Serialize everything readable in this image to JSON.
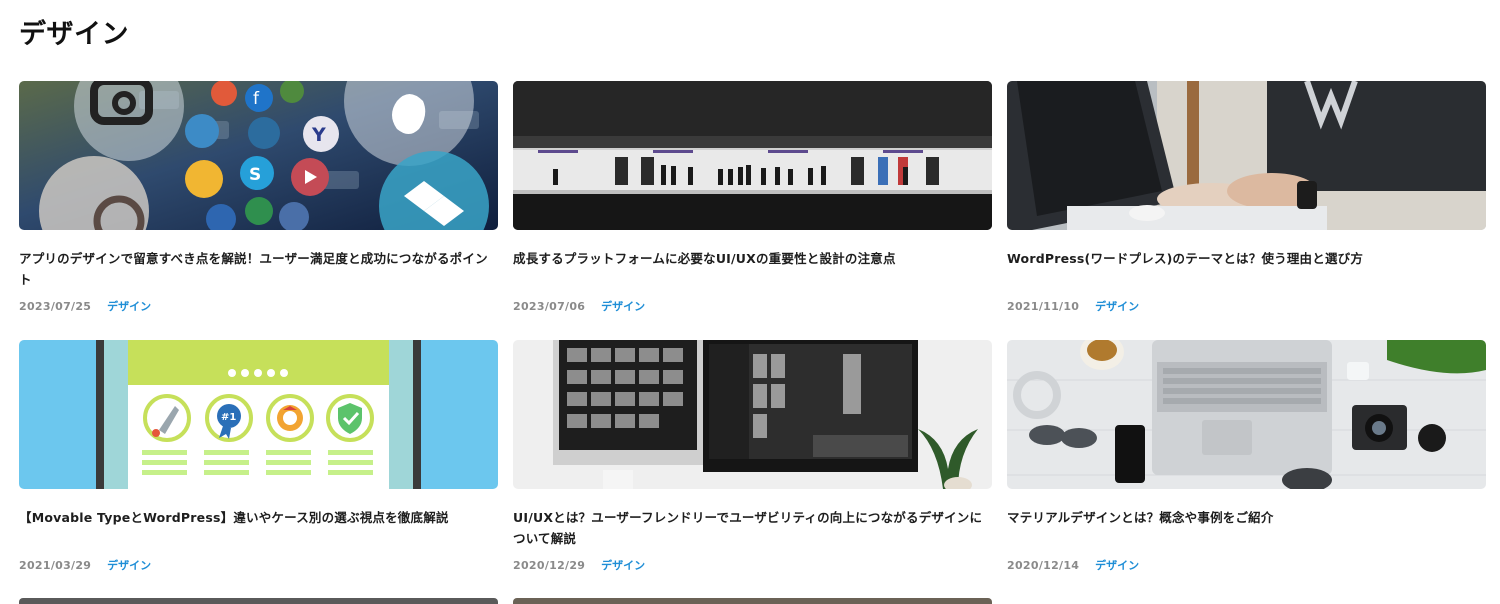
{
  "page": {
    "title": "デザイン"
  },
  "colors": {
    "accent": "#1f8ed6",
    "date": "#8a8a8a"
  },
  "articles": [
    {
      "title": "アプリのデザインで留意すべき点を解説！ユーザー満足度と成功につながるポイント",
      "date": "2023/07/25",
      "category": "デザイン",
      "image": "app-icons-photo"
    },
    {
      "title": "成長するプラットフォームに必要なUI/UXの重要性と設計の注意点",
      "date": "2023/07/06",
      "category": "デザイン",
      "image": "subway-platform-photo"
    },
    {
      "title": "WordPress(ワードプレス)のテーマとは？使う理由と選び方",
      "date": "2021/11/10",
      "category": "デザイン",
      "image": "person-typing-photo"
    },
    {
      "title": "【Movable TypeとWordPress】違いやケース別の選ぶ視点を徹底解説",
      "date": "2021/03/29",
      "category": "デザイン",
      "image": "badges-illustration"
    },
    {
      "title": "UI/UXとは？ユーザーフレンドリーでユーザビリティの向上につながるデザインについて解説",
      "date": "2020/12/29",
      "category": "デザイン",
      "image": "design-monitors-photo"
    },
    {
      "title": "マテリアルデザインとは？概念や事例をご紹介",
      "date": "2020/12/14",
      "category": "デザイン",
      "image": "desk-laptop-photo"
    }
  ]
}
